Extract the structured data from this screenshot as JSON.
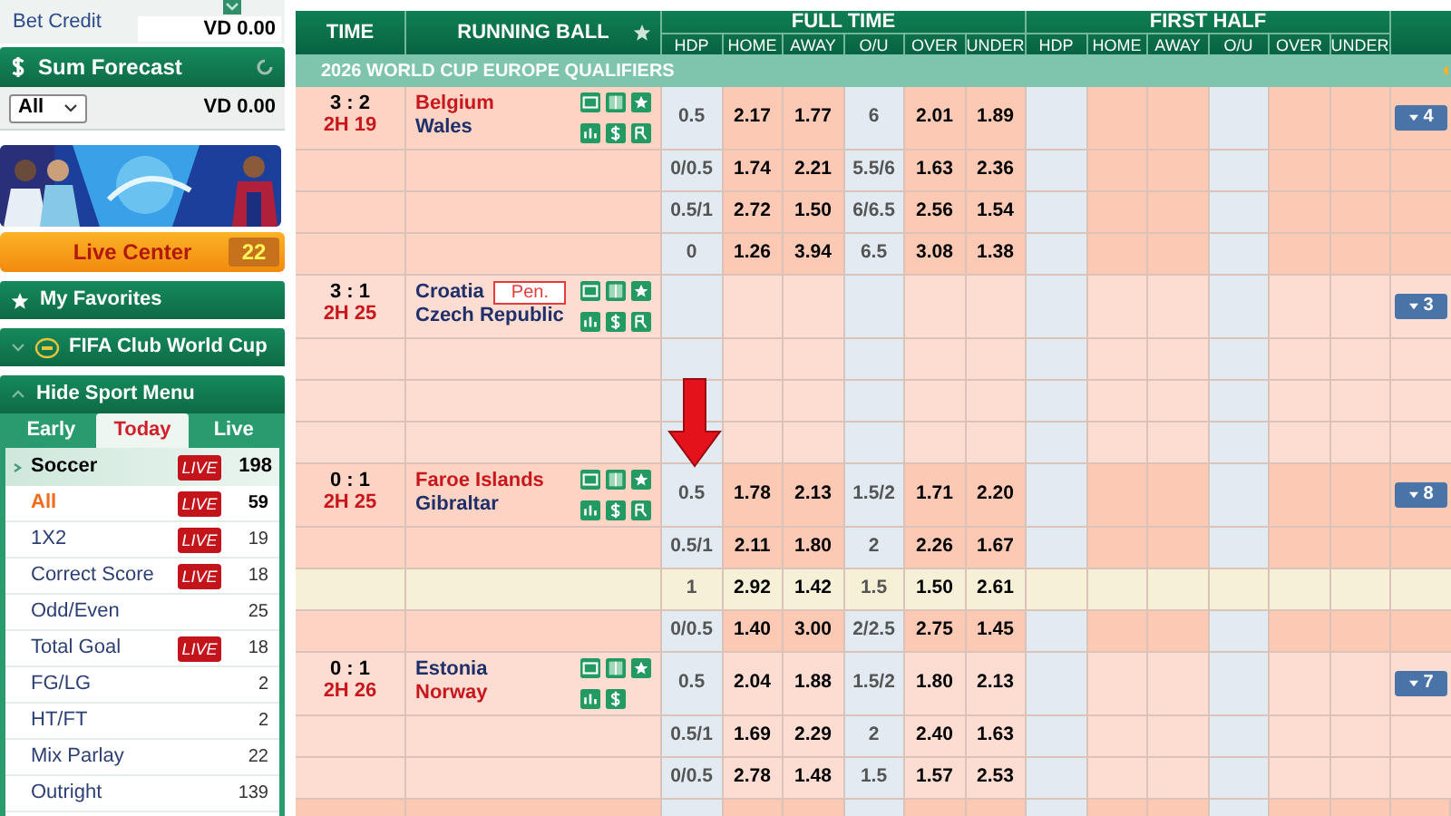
{
  "sidebar": {
    "bet_credit": {
      "label": "Bet Credit",
      "value": "VD 0.00"
    },
    "sum_forecast": {
      "title": "Sum Forecast",
      "filter": "All",
      "value": "VD 0.00"
    },
    "live_center": {
      "label": "Live Center",
      "count": "22"
    },
    "favorites": {
      "label": "My Favorites"
    },
    "featured": {
      "label": "FIFA Club World Cup"
    },
    "menu_toggle": {
      "label": "Hide Sport Menu"
    },
    "tabs": [
      {
        "label": "Early",
        "selected": false
      },
      {
        "label": "Today",
        "selected": true
      },
      {
        "label": "Live",
        "selected": false
      }
    ],
    "sport": {
      "name": "Soccer",
      "badge": "LIVE",
      "count": "198"
    },
    "items": [
      {
        "label": "All",
        "badge": "LIVE",
        "count": "59",
        "selected": true
      },
      {
        "label": "1X2",
        "badge": "LIVE",
        "count": "19",
        "selected": false
      },
      {
        "label": "Correct Score",
        "badge": "LIVE",
        "count": "18",
        "selected": false
      },
      {
        "label": "Odd/Even",
        "count": "25",
        "selected": false
      },
      {
        "label": "Total Goal",
        "badge": "LIVE",
        "count": "18",
        "selected": false
      },
      {
        "label": "FG/LG",
        "count": "2",
        "selected": false
      },
      {
        "label": "HT/FT",
        "count": "2",
        "selected": false
      },
      {
        "label": "Mix Parlay",
        "count": "22",
        "selected": false
      },
      {
        "label": "Outright",
        "count": "139",
        "selected": false
      }
    ]
  },
  "table": {
    "time_header": "TIME",
    "event_header": "RUNNING BALL",
    "groups": [
      {
        "title": "FULL TIME",
        "columns": [
          "HDP",
          "HOME",
          "AWAY",
          "O/U",
          "OVER",
          "UNDER"
        ]
      },
      {
        "title": "FIRST HALF",
        "columns": [
          "HDP",
          "HOME",
          "AWAY",
          "O/U",
          "OVER",
          "UNDER"
        ]
      }
    ],
    "league": "2026 WORLD CUP EUROPE QUALIFIERS",
    "matches": [
      {
        "score": "3 : 2",
        "time": "2H 19",
        "home": {
          "name": "Belgium",
          "favored": true
        },
        "away": {
          "name": "Wales",
          "favored": false
        },
        "more_icon": true,
        "more_count": "4",
        "lines": [
          {
            "kind": "odds",
            "hdp": "0.5",
            "home": "2.17",
            "away": "1.77",
            "ou": "6",
            "over": "2.01",
            "under": "1.89",
            "highlighted": false
          },
          {
            "kind": "odds",
            "hdp": "0/0.5",
            "home": "1.74",
            "away": "2.21",
            "ou": "5.5/6",
            "over": "1.63",
            "under": "2.36",
            "highlighted": false
          },
          {
            "kind": "odds",
            "hdp": "0.5/1",
            "home": "2.72",
            "away": "1.50",
            "ou": "6/6.5",
            "over": "2.56",
            "under": "1.54",
            "highlighted": false
          },
          {
            "kind": "odds",
            "hdp": "0",
            "home": "1.26",
            "away": "3.94",
            "ou": "6.5",
            "over": "3.08",
            "under": "1.38",
            "highlighted": false
          }
        ]
      },
      {
        "score": "3 : 1",
        "time": "2H 25",
        "home": {
          "name": "Croatia",
          "favored": false
        },
        "away": {
          "name": "Czech Republic",
          "favored": false
        },
        "badge": "Pen.",
        "more_icon": true,
        "more_count": "3",
        "lines": [
          {
            "kind": "empty"
          },
          {
            "kind": "empty"
          },
          {
            "kind": "empty"
          },
          {
            "kind": "empty"
          }
        ]
      },
      {
        "score": "0 : 1",
        "time": "2H 25",
        "home": {
          "name": "Faroe Islands",
          "favored": true
        },
        "away": {
          "name": "Gibraltar",
          "favored": false
        },
        "more_icon": true,
        "more_count": "8",
        "lines": [
          {
            "kind": "odds",
            "hdp": "0.5",
            "home": "1.78",
            "away": "2.13",
            "ou": "1.5/2",
            "over": "1.71",
            "under": "2.20",
            "highlighted": false
          },
          {
            "kind": "odds",
            "hdp": "0.5/1",
            "home": "2.11",
            "away": "1.80",
            "ou": "2",
            "over": "2.26",
            "under": "1.67",
            "highlighted": false
          },
          {
            "kind": "odds",
            "hdp": "1",
            "home": "2.92",
            "away": "1.42",
            "ou": "1.5",
            "over": "1.50",
            "under": "2.61",
            "highlighted": true
          },
          {
            "kind": "odds",
            "hdp": "0/0.5",
            "home": "1.40",
            "away": "3.00",
            "ou": "2/2.5",
            "over": "2.75",
            "under": "1.45",
            "highlighted": false
          }
        ]
      },
      {
        "score": "0 : 1",
        "time": "2H 26",
        "home": {
          "name": "Estonia",
          "favored": false
        },
        "away": {
          "name": "Norway",
          "favored": true
        },
        "more_icon": false,
        "more_count": "7",
        "lines": [
          {
            "kind": "odds",
            "hdp": "0.5",
            "home": "2.04",
            "away": "1.88",
            "ou": "1.5/2",
            "over": "1.80",
            "under": "2.13",
            "highlighted": false
          },
          {
            "kind": "odds",
            "hdp": "0.5/1",
            "home": "1.69",
            "away": "2.29",
            "ou": "2",
            "over": "2.40",
            "under": "1.63",
            "highlighted": false
          },
          {
            "kind": "odds",
            "hdp": "0/0.5",
            "home": "2.78",
            "away": "1.48",
            "ou": "1.5",
            "over": "1.57",
            "under": "2.53",
            "highlighted": false
          }
        ]
      }
    ]
  }
}
